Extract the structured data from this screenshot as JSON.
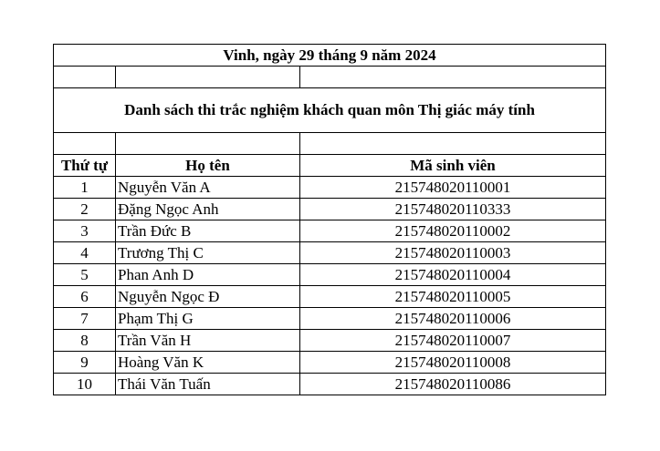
{
  "header": {
    "date_line": "Vinh, ngày 29 tháng 9 năm 2024",
    "title": "Danh sách thi trắc nghiệm khách quan môn Thị giác máy tính"
  },
  "columns": {
    "stt": "Thứ tự",
    "name": "Họ tên",
    "id": "Mã sinh viên"
  },
  "rows": [
    {
      "stt": "1",
      "name": "Nguyễn Văn A",
      "id": "215748020110001"
    },
    {
      "stt": "2",
      "name": "Đặng Ngọc Anh",
      "id": "215748020110333"
    },
    {
      "stt": "3",
      "name": "Trần Đức B",
      "id": "215748020110002"
    },
    {
      "stt": "4",
      "name": "Trương Thị C",
      "id": "215748020110003"
    },
    {
      "stt": "5",
      "name": "Phan Anh D",
      "id": "215748020110004"
    },
    {
      "stt": "6",
      "name": "Nguyễn Ngọc Đ",
      "id": "215748020110005"
    },
    {
      "stt": "7",
      "name": "Phạm Thị G",
      "id": "215748020110006"
    },
    {
      "stt": "8",
      "name": "Trần Văn H",
      "id": "215748020110007"
    },
    {
      "stt": "9",
      "name": "Hoàng Văn K",
      "id": "215748020110008"
    },
    {
      "stt": "10",
      "name": "Thái Văn Tuấn",
      "id": "215748020110086"
    }
  ]
}
